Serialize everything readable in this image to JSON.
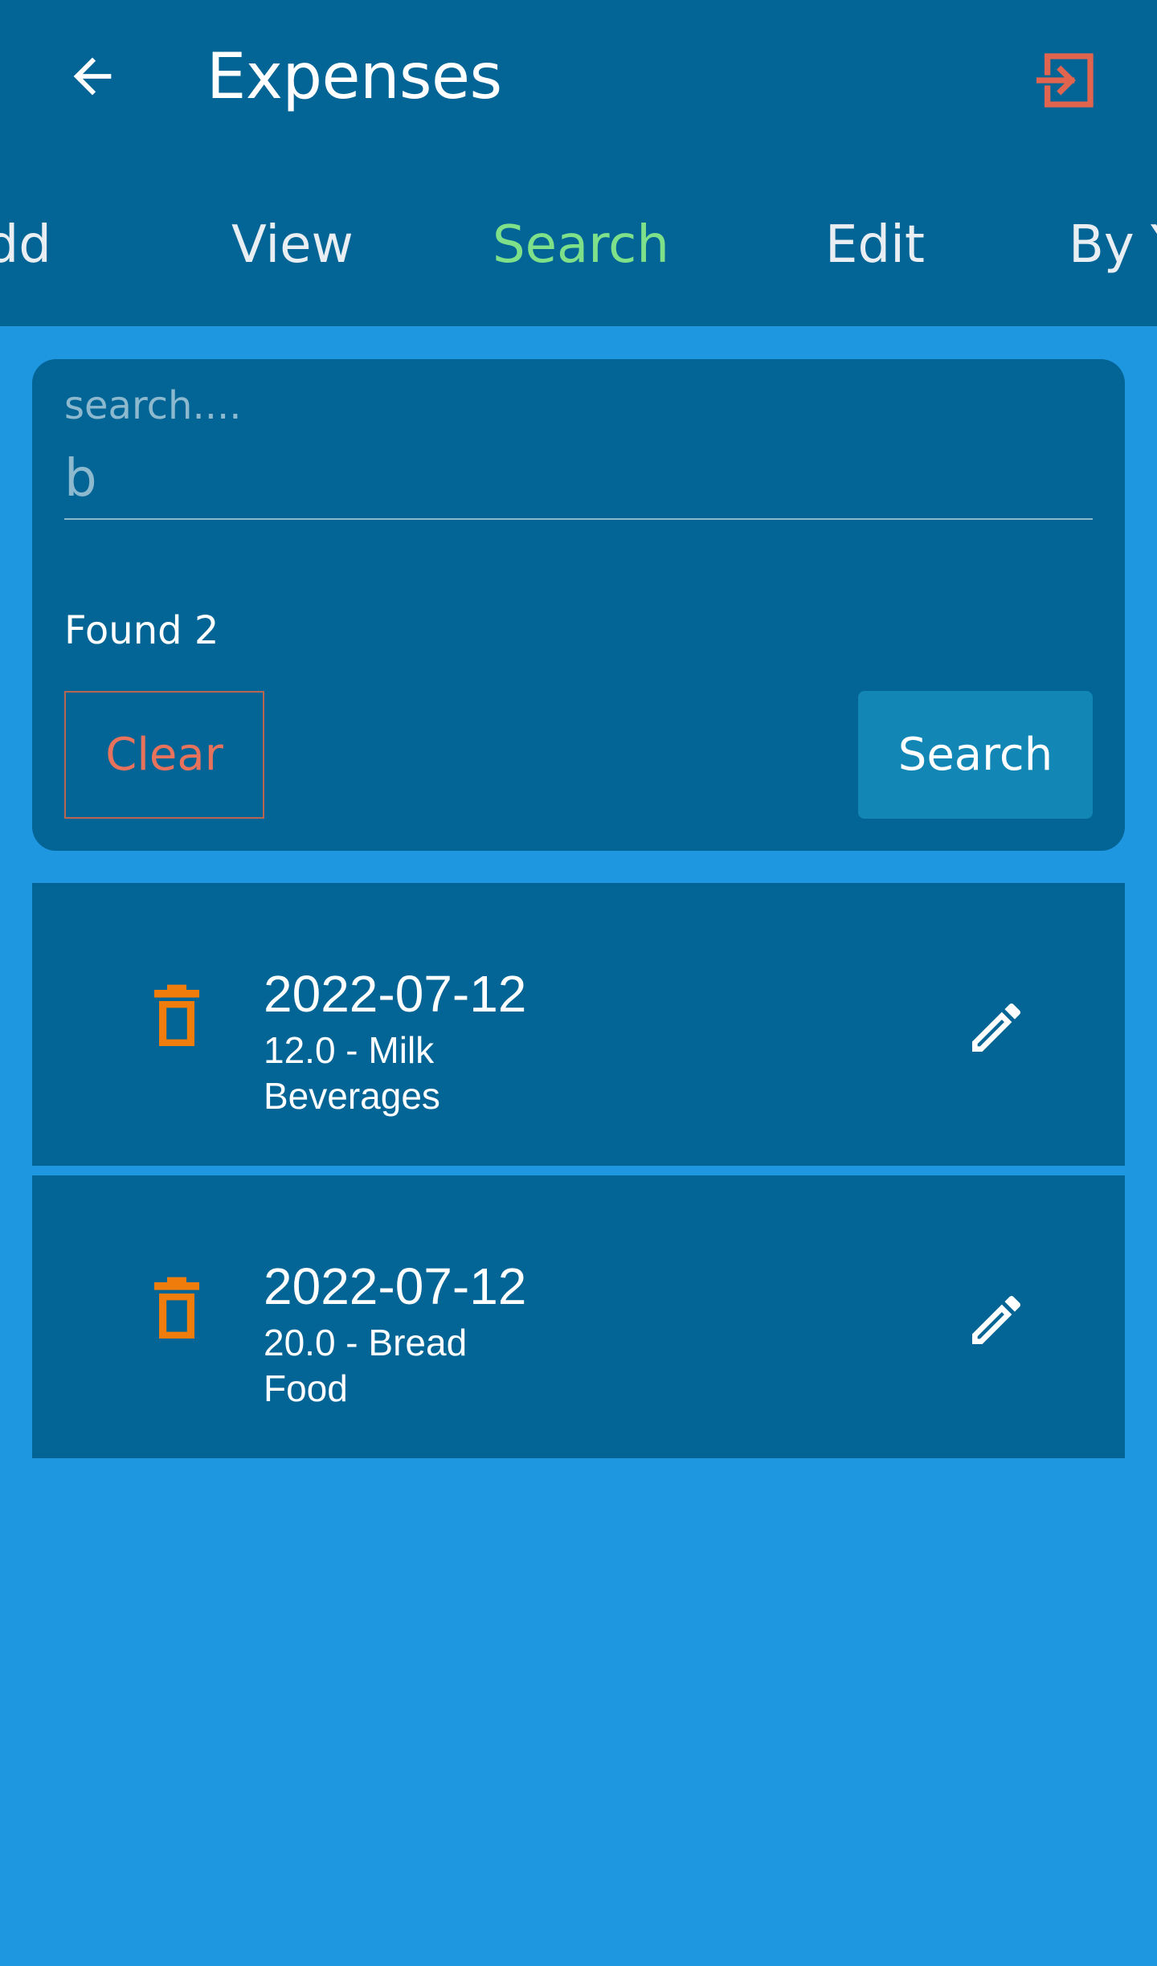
{
  "appbar": {
    "title": "Expenses",
    "back_icon": "arrow-left-icon",
    "logout_icon": "login-exit-icon"
  },
  "tabs": [
    {
      "label": "Add",
      "active": false
    },
    {
      "label": "View",
      "active": false
    },
    {
      "label": "Search",
      "active": true
    },
    {
      "label": "Edit",
      "active": false
    },
    {
      "label": "By Y",
      "active": false
    }
  ],
  "search": {
    "label": "search....",
    "value": "b",
    "found_text": "Found 2",
    "clear_label": "Clear",
    "search_label": "Search"
  },
  "results": [
    {
      "date": "2022-07-12",
      "desc": "12.0 - Milk",
      "category": "Beverages"
    },
    {
      "date": "2022-07-12",
      "desc": "20.0 - Bread",
      "category": "Food"
    }
  ],
  "colors": {
    "appbar": "#036596",
    "background": "#1e96e0",
    "active_tab": "#7fe08a",
    "delete_icon": "#f07c0c",
    "logout_icon": "#e0644e",
    "clear": "#e8725b"
  }
}
